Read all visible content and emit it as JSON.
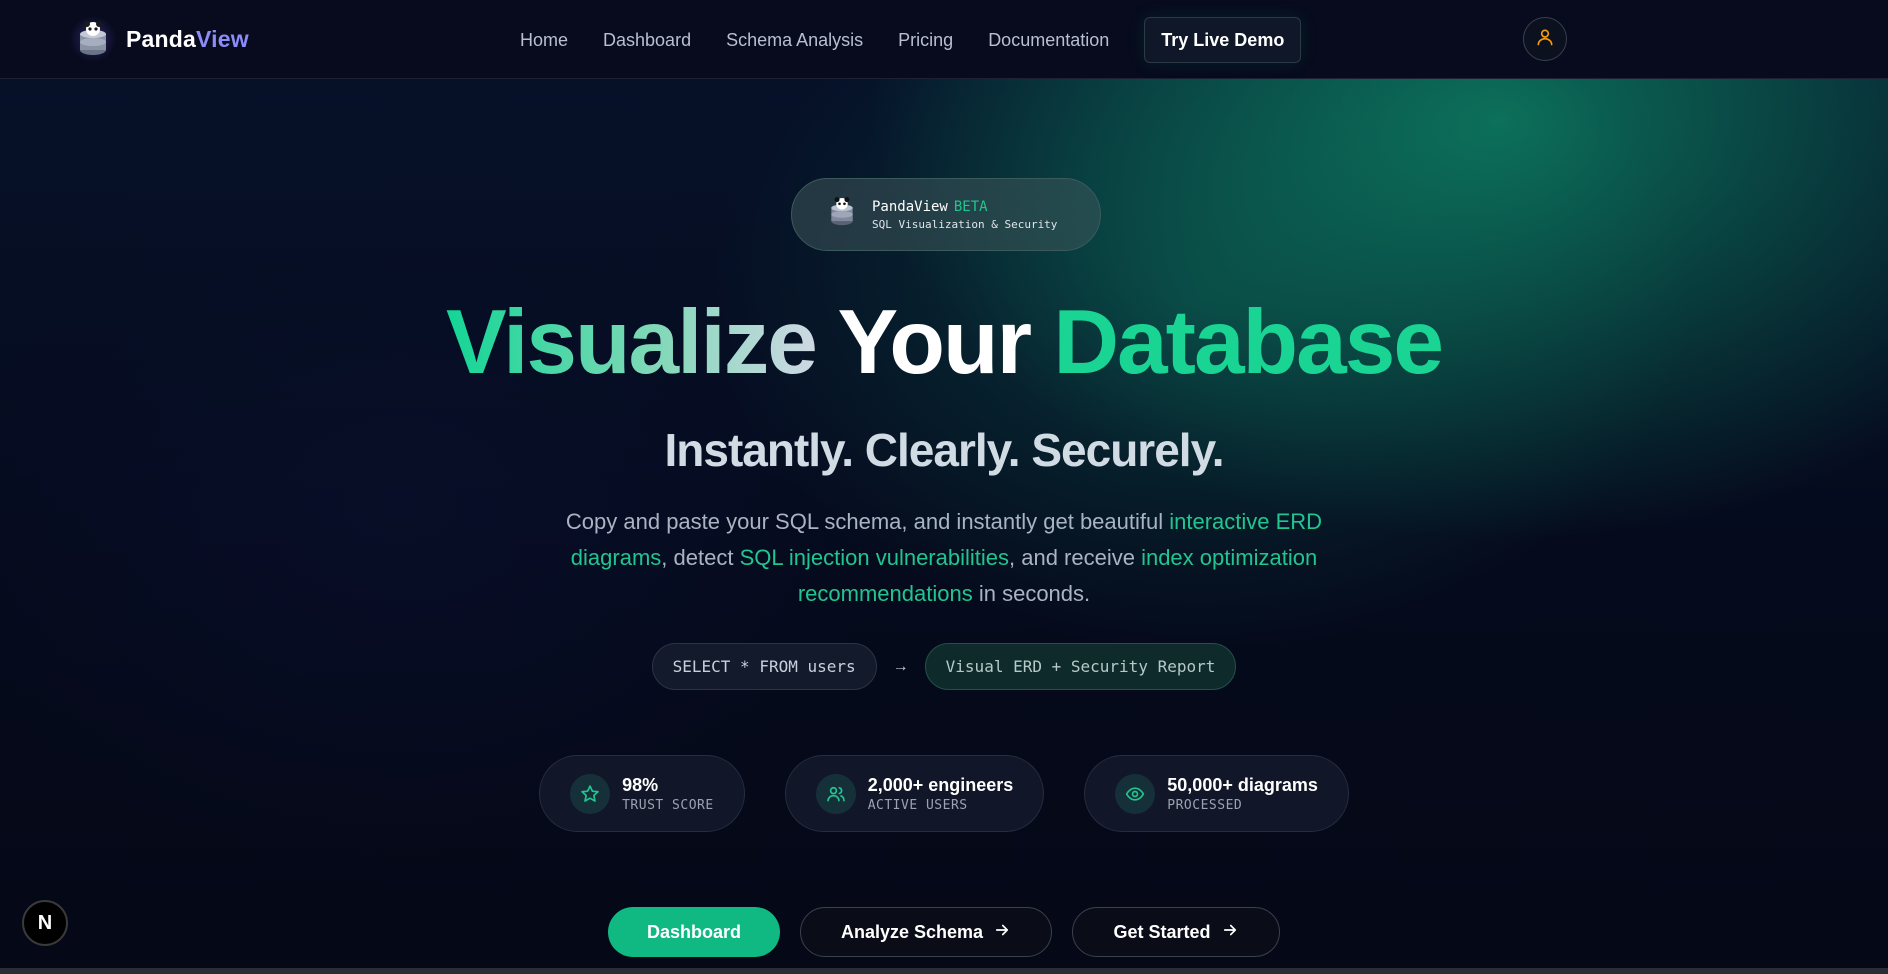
{
  "nav": {
    "brand_a": "Panda",
    "brand_b": "View",
    "links": [
      "Home",
      "Dashboard",
      "Schema Analysis",
      "Pricing",
      "Documentation"
    ],
    "demo_label": "Try Live Demo",
    "user_icon": "user-icon"
  },
  "badge": {
    "title": "PandaView",
    "tag": "BETA",
    "subtitle": "SQL Visualization & Security",
    "icon": "panda-database-icon"
  },
  "hero": {
    "headline_a": "Visualize",
    "headline_b": "Your",
    "headline_c": "Database",
    "subheadline": "Instantly. Clearly. Securely.",
    "desc_1": "Copy and paste your SQL schema, and instantly get beautiful ",
    "desc_hl_1": "interactive ERD diagrams",
    "desc_2": ", detect ",
    "desc_hl_2": "SQL injection vulnerabilities",
    "desc_3": ", and receive ",
    "desc_hl_3": "index optimization recommendations",
    "desc_4": " in seconds."
  },
  "code_example": {
    "input": "SELECT * FROM users",
    "arrow": "→",
    "output": "Visual ERD + Security Report"
  },
  "stats": [
    {
      "value": "98%",
      "label": "TRUST SCORE",
      "icon": "star-icon"
    },
    {
      "value": "2,000+ engineers",
      "label": "ACTIVE USERS",
      "icon": "users-icon"
    },
    {
      "value": "50,000+ diagrams",
      "label": "PROCESSED",
      "icon": "eye-icon"
    }
  ],
  "cta": {
    "dashboard": "Dashboard",
    "analyze": "Analyze Schema",
    "start": "Get Started"
  },
  "dev_badge": "N",
  "colors": {
    "accent": "#10b981",
    "brand_purple": "#8b8cf8",
    "background": "#050816"
  }
}
